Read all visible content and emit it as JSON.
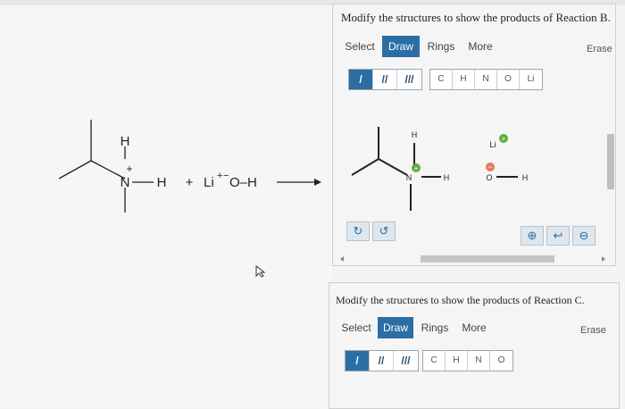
{
  "reaction": {
    "h_top": "H",
    "nitrogen": "N",
    "plus": "+",
    "h_right": "H",
    "plus_sign": "+",
    "li": "Li",
    "li_charge": "+",
    "o_group": "O–H",
    "minus": "−"
  },
  "panel_b": {
    "title": "Modify the structures to show the products of Reaction B.",
    "tabs": [
      "Select",
      "Draw",
      "Rings",
      "More"
    ],
    "erase": "Erase",
    "atoms": [
      "C",
      "H",
      "N",
      "O",
      "Li"
    ],
    "canvas": {
      "h_top": "H",
      "n": "N",
      "h_right": "H",
      "li": "Li",
      "o": "O",
      "oh_h": "H",
      "plus": "+",
      "minus": "−"
    }
  },
  "panel_c": {
    "title": "Modify the structures to show the products of Reaction C.",
    "tabs": [
      "Select",
      "Draw",
      "Rings",
      "More"
    ],
    "erase": "Erase",
    "atoms": [
      "C",
      "H",
      "N",
      "O"
    ]
  },
  "colors": {
    "accent": "#2c6da4",
    "charge": "#5fae3a"
  },
  "icons": [
    "undo-icon",
    "redo-icon",
    "zoom-in-icon",
    "reset-icon",
    "zoom-out-icon"
  ]
}
